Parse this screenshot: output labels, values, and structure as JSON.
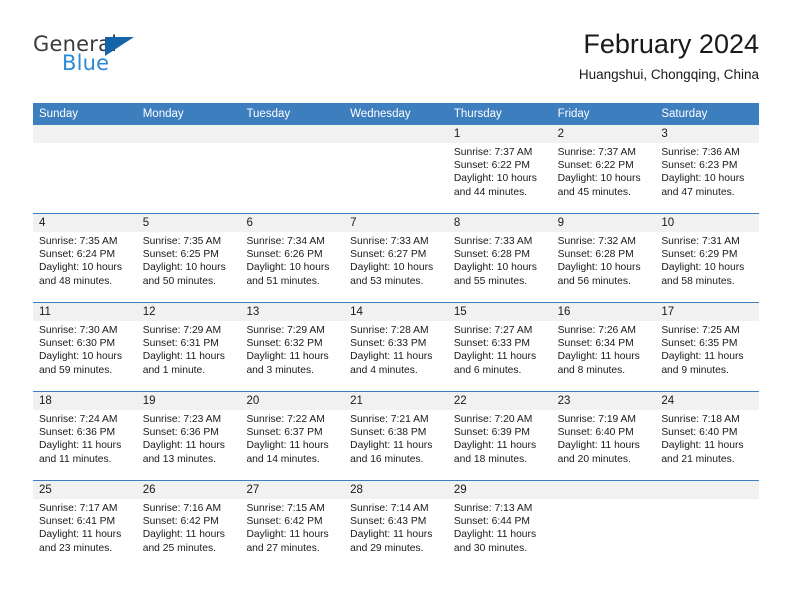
{
  "brand": {
    "name_top": "General",
    "name_bottom": "Blue",
    "triangle_color": "#1464aa",
    "blue_color": "#2c8ad6"
  },
  "header": {
    "title": "February 2024",
    "subtitle": "Huangshui, Chongqing, China"
  },
  "theme": {
    "header_blue": "#3d7ebf",
    "daynum_band": "#f1f1f1",
    "text": "#1a1a1a"
  },
  "weekdays": [
    "Sunday",
    "Monday",
    "Tuesday",
    "Wednesday",
    "Thursday",
    "Friday",
    "Saturday"
  ],
  "weeks": [
    [
      {
        "day": "",
        "sunrise": "",
        "sunset": "",
        "daylight_1": "",
        "daylight_2": ""
      },
      {
        "day": "",
        "sunrise": "",
        "sunset": "",
        "daylight_1": "",
        "daylight_2": ""
      },
      {
        "day": "",
        "sunrise": "",
        "sunset": "",
        "daylight_1": "",
        "daylight_2": ""
      },
      {
        "day": "",
        "sunrise": "",
        "sunset": "",
        "daylight_1": "",
        "daylight_2": ""
      },
      {
        "day": "1",
        "sunrise": "Sunrise: 7:37 AM",
        "sunset": "Sunset: 6:22 PM",
        "daylight_1": "Daylight: 10 hours",
        "daylight_2": "and 44 minutes."
      },
      {
        "day": "2",
        "sunrise": "Sunrise: 7:37 AM",
        "sunset": "Sunset: 6:22 PM",
        "daylight_1": "Daylight: 10 hours",
        "daylight_2": "and 45 minutes."
      },
      {
        "day": "3",
        "sunrise": "Sunrise: 7:36 AM",
        "sunset": "Sunset: 6:23 PM",
        "daylight_1": "Daylight: 10 hours",
        "daylight_2": "and 47 minutes."
      }
    ],
    [
      {
        "day": "4",
        "sunrise": "Sunrise: 7:35 AM",
        "sunset": "Sunset: 6:24 PM",
        "daylight_1": "Daylight: 10 hours",
        "daylight_2": "and 48 minutes."
      },
      {
        "day": "5",
        "sunrise": "Sunrise: 7:35 AM",
        "sunset": "Sunset: 6:25 PM",
        "daylight_1": "Daylight: 10 hours",
        "daylight_2": "and 50 minutes."
      },
      {
        "day": "6",
        "sunrise": "Sunrise: 7:34 AM",
        "sunset": "Sunset: 6:26 PM",
        "daylight_1": "Daylight: 10 hours",
        "daylight_2": "and 51 minutes."
      },
      {
        "day": "7",
        "sunrise": "Sunrise: 7:33 AM",
        "sunset": "Sunset: 6:27 PM",
        "daylight_1": "Daylight: 10 hours",
        "daylight_2": "and 53 minutes."
      },
      {
        "day": "8",
        "sunrise": "Sunrise: 7:33 AM",
        "sunset": "Sunset: 6:28 PM",
        "daylight_1": "Daylight: 10 hours",
        "daylight_2": "and 55 minutes."
      },
      {
        "day": "9",
        "sunrise": "Sunrise: 7:32 AM",
        "sunset": "Sunset: 6:28 PM",
        "daylight_1": "Daylight: 10 hours",
        "daylight_2": "and 56 minutes."
      },
      {
        "day": "10",
        "sunrise": "Sunrise: 7:31 AM",
        "sunset": "Sunset: 6:29 PM",
        "daylight_1": "Daylight: 10 hours",
        "daylight_2": "and 58 minutes."
      }
    ],
    [
      {
        "day": "11",
        "sunrise": "Sunrise: 7:30 AM",
        "sunset": "Sunset: 6:30 PM",
        "daylight_1": "Daylight: 10 hours",
        "daylight_2": "and 59 minutes."
      },
      {
        "day": "12",
        "sunrise": "Sunrise: 7:29 AM",
        "sunset": "Sunset: 6:31 PM",
        "daylight_1": "Daylight: 11 hours",
        "daylight_2": "and 1 minute."
      },
      {
        "day": "13",
        "sunrise": "Sunrise: 7:29 AM",
        "sunset": "Sunset: 6:32 PM",
        "daylight_1": "Daylight: 11 hours",
        "daylight_2": "and 3 minutes."
      },
      {
        "day": "14",
        "sunrise": "Sunrise: 7:28 AM",
        "sunset": "Sunset: 6:33 PM",
        "daylight_1": "Daylight: 11 hours",
        "daylight_2": "and 4 minutes."
      },
      {
        "day": "15",
        "sunrise": "Sunrise: 7:27 AM",
        "sunset": "Sunset: 6:33 PM",
        "daylight_1": "Daylight: 11 hours",
        "daylight_2": "and 6 minutes."
      },
      {
        "day": "16",
        "sunrise": "Sunrise: 7:26 AM",
        "sunset": "Sunset: 6:34 PM",
        "daylight_1": "Daylight: 11 hours",
        "daylight_2": "and 8 minutes."
      },
      {
        "day": "17",
        "sunrise": "Sunrise: 7:25 AM",
        "sunset": "Sunset: 6:35 PM",
        "daylight_1": "Daylight: 11 hours",
        "daylight_2": "and 9 minutes."
      }
    ],
    [
      {
        "day": "18",
        "sunrise": "Sunrise: 7:24 AM",
        "sunset": "Sunset: 6:36 PM",
        "daylight_1": "Daylight: 11 hours",
        "daylight_2": "and 11 minutes."
      },
      {
        "day": "19",
        "sunrise": "Sunrise: 7:23 AM",
        "sunset": "Sunset: 6:36 PM",
        "daylight_1": "Daylight: 11 hours",
        "daylight_2": "and 13 minutes."
      },
      {
        "day": "20",
        "sunrise": "Sunrise: 7:22 AM",
        "sunset": "Sunset: 6:37 PM",
        "daylight_1": "Daylight: 11 hours",
        "daylight_2": "and 14 minutes."
      },
      {
        "day": "21",
        "sunrise": "Sunrise: 7:21 AM",
        "sunset": "Sunset: 6:38 PM",
        "daylight_1": "Daylight: 11 hours",
        "daylight_2": "and 16 minutes."
      },
      {
        "day": "22",
        "sunrise": "Sunrise: 7:20 AM",
        "sunset": "Sunset: 6:39 PM",
        "daylight_1": "Daylight: 11 hours",
        "daylight_2": "and 18 minutes."
      },
      {
        "day": "23",
        "sunrise": "Sunrise: 7:19 AM",
        "sunset": "Sunset: 6:40 PM",
        "daylight_1": "Daylight: 11 hours",
        "daylight_2": "and 20 minutes."
      },
      {
        "day": "24",
        "sunrise": "Sunrise: 7:18 AM",
        "sunset": "Sunset: 6:40 PM",
        "daylight_1": "Daylight: 11 hours",
        "daylight_2": "and 21 minutes."
      }
    ],
    [
      {
        "day": "25",
        "sunrise": "Sunrise: 7:17 AM",
        "sunset": "Sunset: 6:41 PM",
        "daylight_1": "Daylight: 11 hours",
        "daylight_2": "and 23 minutes."
      },
      {
        "day": "26",
        "sunrise": "Sunrise: 7:16 AM",
        "sunset": "Sunset: 6:42 PM",
        "daylight_1": "Daylight: 11 hours",
        "daylight_2": "and 25 minutes."
      },
      {
        "day": "27",
        "sunrise": "Sunrise: 7:15 AM",
        "sunset": "Sunset: 6:42 PM",
        "daylight_1": "Daylight: 11 hours",
        "daylight_2": "and 27 minutes."
      },
      {
        "day": "28",
        "sunrise": "Sunrise: 7:14 AM",
        "sunset": "Sunset: 6:43 PM",
        "daylight_1": "Daylight: 11 hours",
        "daylight_2": "and 29 minutes."
      },
      {
        "day": "29",
        "sunrise": "Sunrise: 7:13 AM",
        "sunset": "Sunset: 6:44 PM",
        "daylight_1": "Daylight: 11 hours",
        "daylight_2": "and 30 minutes."
      },
      {
        "day": "",
        "sunrise": "",
        "sunset": "",
        "daylight_1": "",
        "daylight_2": ""
      },
      {
        "day": "",
        "sunrise": "",
        "sunset": "",
        "daylight_1": "",
        "daylight_2": ""
      }
    ]
  ]
}
